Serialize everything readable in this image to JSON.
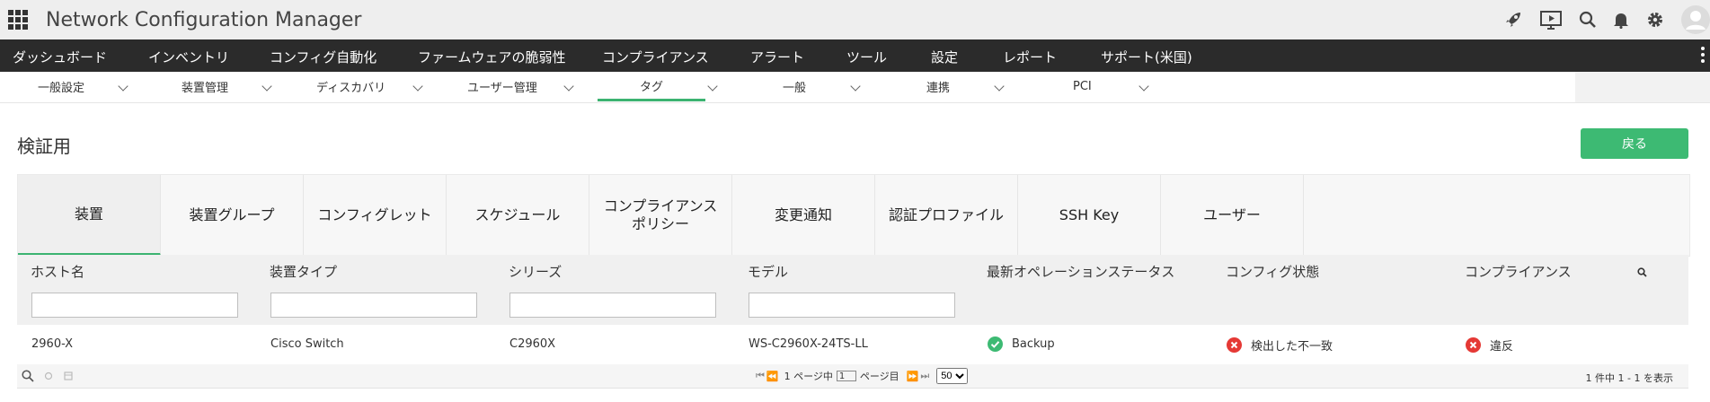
{
  "app": {
    "title": "Network Configuration Manager"
  },
  "main_nav": [
    "ダッシュボード",
    "インベントリ",
    "コンフィグ自動化",
    "ファームウェアの脆弱性",
    "コンプライアンス",
    "アラート",
    "ツール",
    "設定",
    "レポート",
    "サポート(米国)"
  ],
  "sub_nav": [
    "一般設定",
    "装置管理",
    "ディスカバリ",
    "ユーザー管理",
    "タグ",
    "一般",
    "連携",
    "PCI"
  ],
  "sub_nav_active": "タグ",
  "page": {
    "title": "検証用",
    "back_label": "戻る"
  },
  "tabs": [
    "装置",
    "装置グループ",
    "コンフィグレット",
    "スケジュール",
    "コンプライアンス\nポリシー",
    "変更通知",
    "認証プロファイル",
    "SSH Key",
    "ユーザー"
  ],
  "active_tab": "装置",
  "table": {
    "headers": [
      "ホスト名",
      "装置タイプ",
      "シリーズ",
      "モデル",
      "最新オペレーションステータス",
      "コンフィグ状態",
      "コンプライアンス"
    ],
    "rows": [
      {
        "host": "2960-X",
        "type": "Cisco Switch",
        "series": "C2960X",
        "model": "WS-C2960X-24TS-LL",
        "op_status": "Backup",
        "config_state": "検出した不一致",
        "compliance": "違反"
      }
    ]
  },
  "pager": {
    "page_prefix": "1 ページ中",
    "page_value": "1",
    "page_suffix": "ページ目",
    "page_size": "50",
    "page_size_options": [
      "50"
    ],
    "row_info": "1 件中 1 - 1 を表示"
  },
  "colors": {
    "accent": "#3dba73",
    "error": "#e53935",
    "nav_bg": "#2b2b2b"
  }
}
